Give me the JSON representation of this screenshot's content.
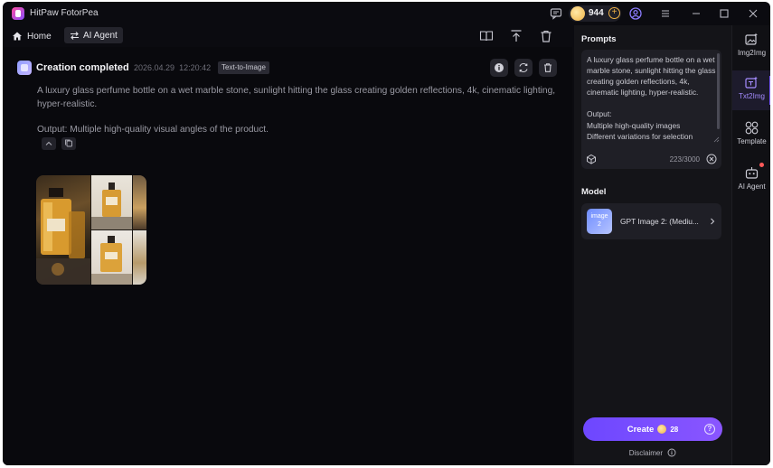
{
  "app": {
    "title": "HitPaw FotorPea",
    "coins": "944"
  },
  "nav": {
    "home_label": "Home",
    "agent_label": "AI Agent"
  },
  "result": {
    "status": "Creation completed",
    "date": "2026.04.29",
    "time": "12:20:42",
    "mode_badge": "Text-to-Image",
    "prompt_line": "A luxury glass perfume bottle on a wet marble stone, sunlight hitting the glass creating golden reflections, 4k, cinematic lighting, hyper-realistic.",
    "output_line": "Output: Multiple high-quality visual angles of the product."
  },
  "panel": {
    "prompts_title": "Prompts",
    "prompt_text": "A luxury glass perfume bottle on a wet marble stone, sunlight hitting the glass creating golden reflections, 4k, cinematic lighting, hyper-realistic.\n\nOutput:\nMultiple high-quality images\nDifferent variations for selection",
    "char_count": "223/3000",
    "model_title": "Model",
    "model_thumb_label": "image\n2",
    "model_name": "GPT Image 2: (Mediu...",
    "create_label": "Create",
    "create_cost": "28",
    "disclaimer": "Disclaimer"
  },
  "sidebar": {
    "items": [
      {
        "label": "Img2Img"
      },
      {
        "label": "Txt2Img"
      },
      {
        "label": "Template"
      },
      {
        "label": "AI Agent"
      }
    ]
  },
  "colors": {
    "accent": "#7a5cff",
    "coin": "#f0b245",
    "background": "#0b0b10",
    "panel": "#141418"
  }
}
